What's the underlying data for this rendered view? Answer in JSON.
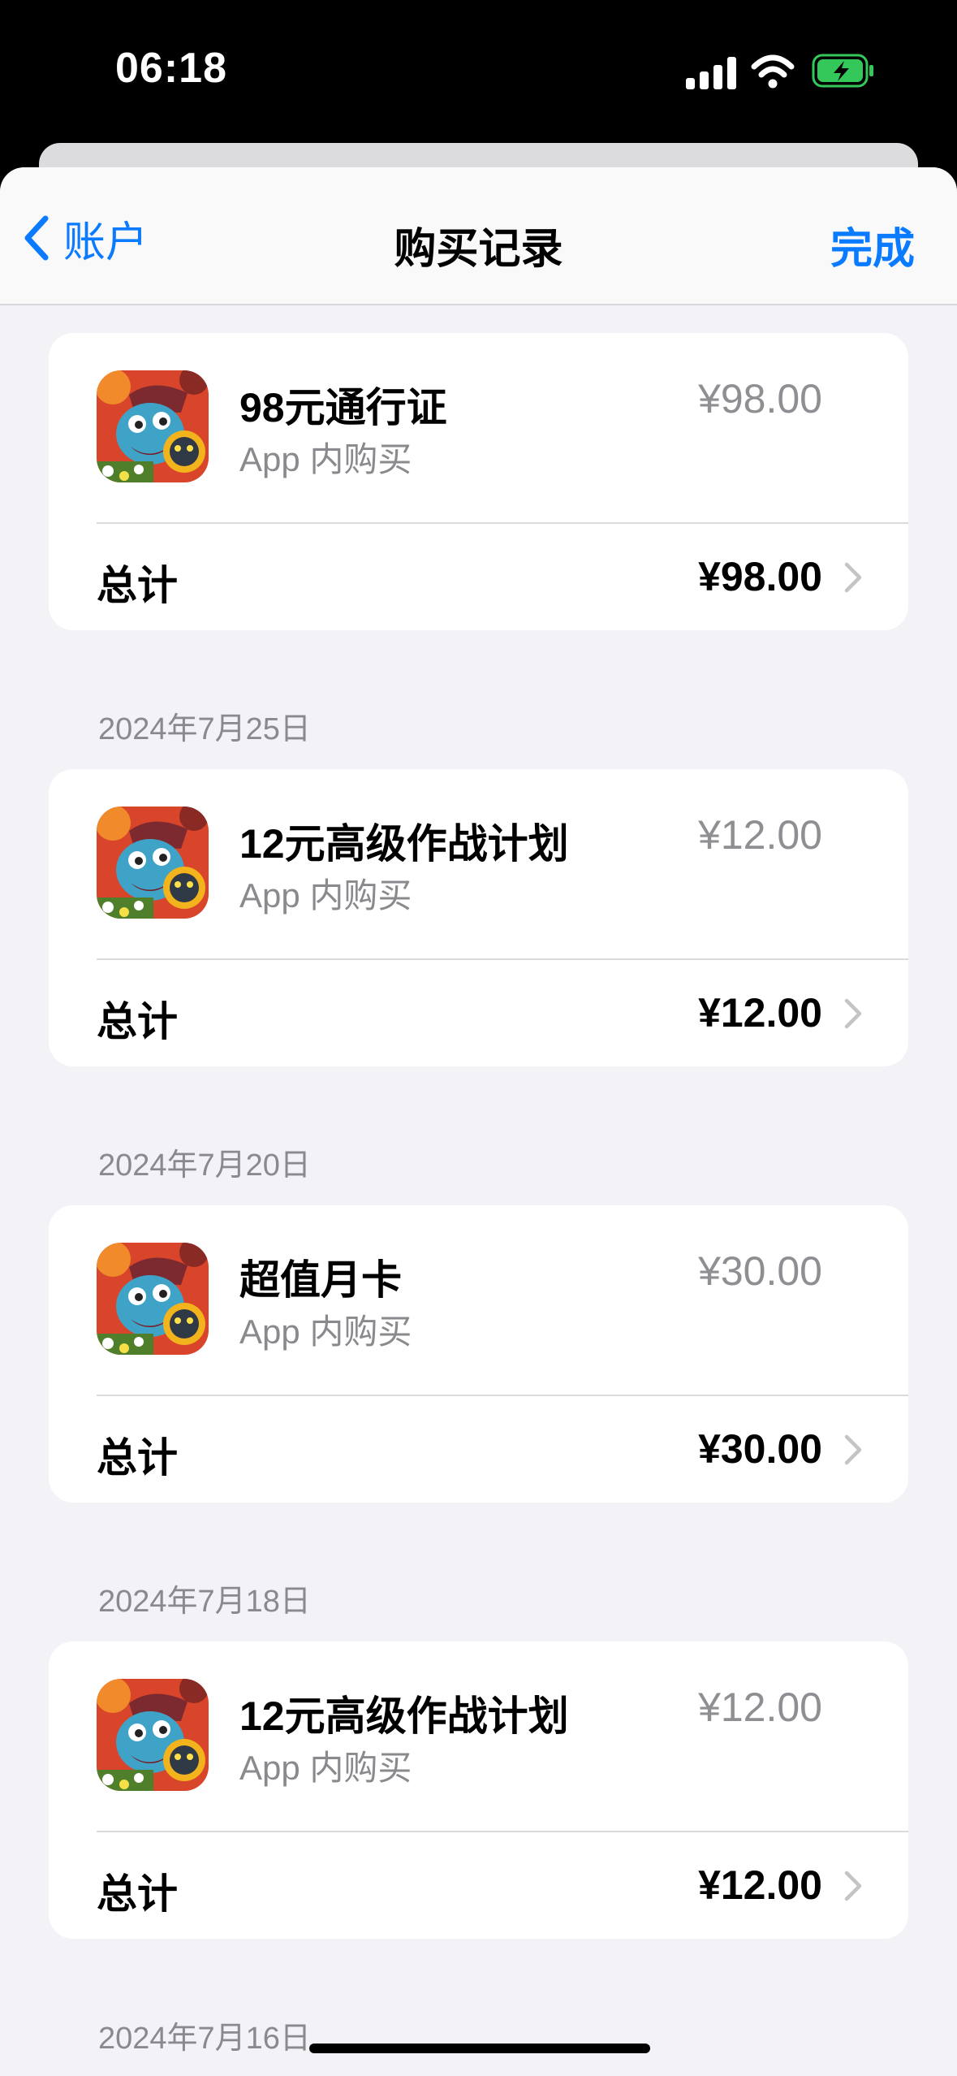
{
  "status_bar": {
    "time": "06:18"
  },
  "nav": {
    "back_label": "账户",
    "title": "购买记录",
    "done_label": "完成"
  },
  "purchases": [
    {
      "date": "",
      "name": "98元通行证",
      "type": "App 内购买",
      "price": "¥98.00",
      "total_label": "总计",
      "total": "¥98.00"
    },
    {
      "date": "2024年7月25日",
      "name": "12元高级作战计划",
      "type": "App 内购买",
      "price": "¥12.00",
      "total_label": "总计",
      "total": "¥12.00"
    },
    {
      "date": "2024年7月20日",
      "name": "超值月卡",
      "type": "App 内购买",
      "price": "¥30.00",
      "total_label": "总计",
      "total": "¥30.00"
    },
    {
      "date": "2024年7月18日",
      "name": "12元高级作战计划",
      "type": "App 内购买",
      "price": "¥12.00",
      "total_label": "总计",
      "total": "¥12.00"
    }
  ],
  "next_date": "2024年7月16日",
  "colors": {
    "accent": "#0a7aff",
    "background": "#f2f2f7",
    "secondary_text": "#8a8a8e",
    "battery_charging": "#34c759"
  }
}
